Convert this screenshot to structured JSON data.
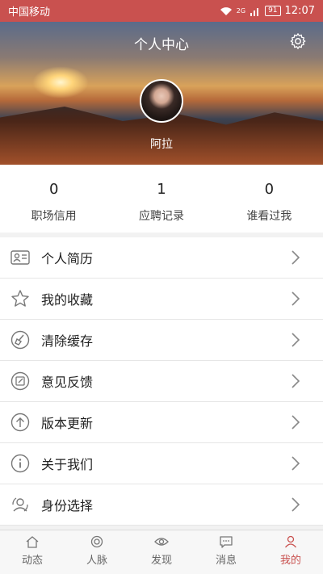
{
  "status": {
    "carrier": "中国移动",
    "network": "2G",
    "battery": "91",
    "time": "12:07"
  },
  "header": {
    "title": "个人中心",
    "username": "阿拉"
  },
  "stats": [
    {
      "value": "0",
      "label": "职场信用"
    },
    {
      "value": "1",
      "label": "应聘记录"
    },
    {
      "value": "0",
      "label": "谁看过我"
    }
  ],
  "menu": [
    {
      "label": "个人简历",
      "icon": "resume-card-icon"
    },
    {
      "label": "我的收藏",
      "icon": "star-icon"
    },
    {
      "label": "清除缓存",
      "icon": "broom-icon"
    },
    {
      "label": "意见反馈",
      "icon": "feedback-icon"
    },
    {
      "label": "版本更新",
      "icon": "upload-arrow-icon"
    },
    {
      "label": "关于我们",
      "icon": "info-icon"
    },
    {
      "label": "身份选择",
      "icon": "user-switch-icon"
    }
  ],
  "tabs": [
    {
      "label": "动态",
      "icon": "home-icon"
    },
    {
      "label": "人脉",
      "icon": "contacts-icon"
    },
    {
      "label": "发现",
      "icon": "eye-icon"
    },
    {
      "label": "消息",
      "icon": "message-icon"
    },
    {
      "label": "我的",
      "icon": "person-icon",
      "active": true
    }
  ],
  "colors": {
    "accent": "#c9514f",
    "separator": "#e6e6e6"
  }
}
